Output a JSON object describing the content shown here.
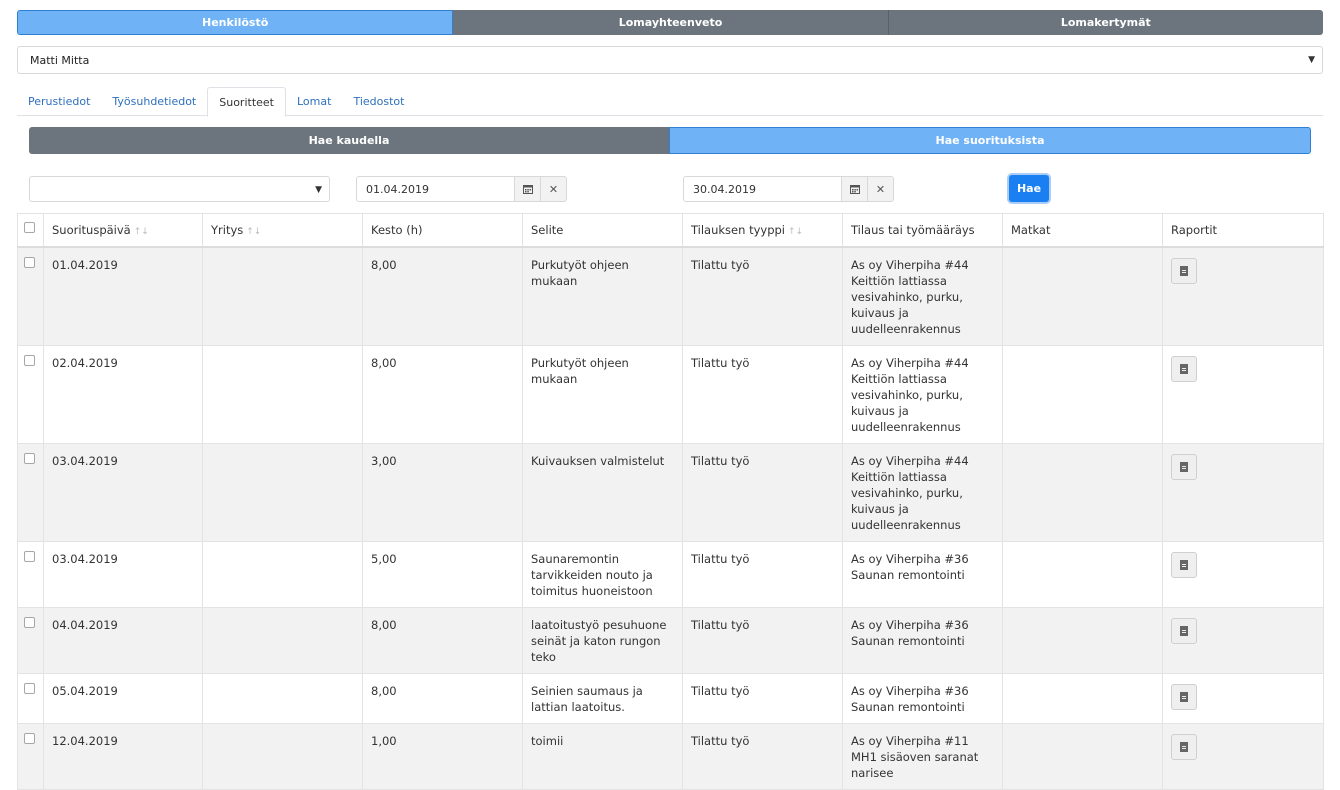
{
  "top_tabs": [
    "Henkilöstö",
    "Lomayhteenveto",
    "Lomakertymät"
  ],
  "person": {
    "value": "Matti Mitta"
  },
  "sub_tabs": [
    "Perustiedot",
    "Työsuhdetiedot",
    "Suoritteet",
    "Lomat",
    "Tiedostot"
  ],
  "active_sub_tab": "Suoritteet",
  "search_modes": [
    "Hae kaudella",
    "Hae suorituksista"
  ],
  "filters": {
    "select_value": "",
    "start_date": "01.04.2019",
    "end_date": "30.04.2019",
    "search_button": "Hae"
  },
  "icons": {
    "calendar": "calendar-icon",
    "clear": "clear-icon",
    "report": "file-icon"
  },
  "colors": {
    "active_blue": "#6fb3f6",
    "segment_gray": "#6c757d",
    "primary": "#1a7ff0"
  },
  "table": {
    "headers": [
      "Suorituspäivä",
      "Yritys",
      "Kesto (h)",
      "Selite",
      "Tilauksen tyyppi",
      "Tilaus tai työmääräys",
      "Matkat",
      "Raportit"
    ],
    "rows": [
      {
        "date": "01.04.2019",
        "company": "",
        "hours": "8,00",
        "desc": "Purkutyöt ohjeen mukaan",
        "type": "Tilattu työ",
        "order": "As oy Viherpiha #44 Keittiön lattiassa vesivahinko, purku, kuivaus ja uudelleenrakennus",
        "trips": ""
      },
      {
        "date": "02.04.2019",
        "company": "",
        "hours": "8,00",
        "desc": "Purkutyöt ohjeen mukaan",
        "type": "Tilattu työ",
        "order": "As oy Viherpiha #44 Keittiön lattiassa vesivahinko, purku, kuivaus ja uudelleenrakennus",
        "trips": ""
      },
      {
        "date": "03.04.2019",
        "company": "",
        "hours": "3,00",
        "desc": "Kuivauksen valmistelut",
        "type": "Tilattu työ",
        "order": "As oy Viherpiha #44 Keittiön lattiassa vesivahinko, purku, kuivaus ja uudelleenrakennus",
        "trips": ""
      },
      {
        "date": "03.04.2019",
        "company": "",
        "hours": "5,00",
        "desc": "Saunaremontin tarvikkeiden nouto ja toimitus huoneistoon",
        "type": "Tilattu työ",
        "order": "As oy Viherpiha #36 Saunan remontointi",
        "trips": ""
      },
      {
        "date": "04.04.2019",
        "company": "",
        "hours": "8,00",
        "desc": "laatoitustyö pesuhuone seinät ja katon rungon teko",
        "type": "Tilattu työ",
        "order": "As oy Viherpiha #36 Saunan remontointi",
        "trips": ""
      },
      {
        "date": "05.04.2019",
        "company": "",
        "hours": "8,00",
        "desc": "Seinien saumaus ja lattian laatoitus.",
        "type": "Tilattu työ",
        "order": "As oy Viherpiha #36 Saunan remontointi",
        "trips": ""
      },
      {
        "date": "12.04.2019",
        "company": "",
        "hours": "1,00",
        "desc": "toimii",
        "type": "Tilattu työ",
        "order": "As oy Viherpiha #11 MH1 sisäoven saranat narisee",
        "trips": ""
      }
    ]
  }
}
